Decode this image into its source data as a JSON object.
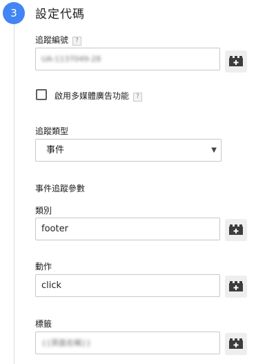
{
  "step": {
    "number": "3",
    "title": "設定代碼"
  },
  "tracking_id": {
    "label": "追蹤編號",
    "help": "?",
    "value": "UA-1137049-28"
  },
  "display_features": {
    "label": "啟用多媒體廣告功能",
    "help": "?",
    "checked": false
  },
  "track_type": {
    "label": "追蹤類型",
    "selected": "事件"
  },
  "event_section_label": "事件追蹤參數",
  "category": {
    "label": "類別",
    "value": "footer"
  },
  "action": {
    "label": "動作",
    "value": "click"
  },
  "event_label": {
    "label": "標籤",
    "value": "{{頁面名稱}}"
  },
  "icons": {
    "variable_picker": "variable-brick-icon"
  },
  "colors": {
    "accent": "#4285f4",
    "border": "#c7c7c7",
    "button_bg": "#eeeeee"
  }
}
